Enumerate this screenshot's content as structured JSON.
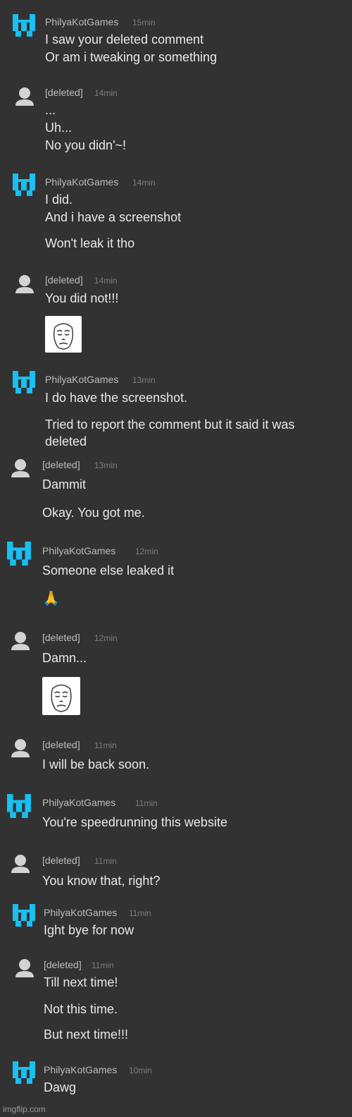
{
  "comments": [
    {
      "user": "PhilyaKotGames",
      "time": "15min",
      "lines": [
        "I saw your deleted comment",
        "Or am i tweaking or something"
      ]
    },
    {
      "user": "[deleted]",
      "time": "14min",
      "lines": [
        "...",
        "Uh...",
        "No you didn'~!"
      ]
    },
    {
      "user": "PhilyaKotGames",
      "time": "14min",
      "lines": [
        "I did.",
        "And i have a screenshot",
        "Won't leak it tho"
      ]
    },
    {
      "user": "[deleted]",
      "time": "14min",
      "lines": [
        "You did not!!!"
      ]
    },
    {
      "user": "PhilyaKotGames",
      "time": "13min",
      "lines": [
        "I do have the screenshot.",
        "Tried to report the comment but it said it was",
        "deleted"
      ]
    },
    {
      "user": "[deleted]",
      "time": "13min",
      "lines": [
        "Dammit",
        "Okay. You got me."
      ]
    },
    {
      "user": "PhilyaKotGames",
      "time": "12min",
      "lines": [
        "Someone else leaked it",
        "🙏"
      ]
    },
    {
      "user": "[deleted]",
      "time": "12min",
      "lines": [
        "Damn..."
      ]
    },
    {
      "user": "[deleted]",
      "time": "11min",
      "lines": [
        "I will be back soon."
      ]
    },
    {
      "user": "PhilyaKotGames",
      "time": "11min",
      "lines": [
        "You're speedrunning this website"
      ]
    },
    {
      "user": "[deleted]",
      "time": "11min",
      "lines": [
        "You know that, right?"
      ]
    },
    {
      "user": "PhilyaKotGames",
      "time": "11min",
      "lines": [
        "Ight bye for now"
      ]
    },
    {
      "user": "[deleted]",
      "time": "11min",
      "lines": [
        "Till next time!",
        "Not this time.",
        "But next time!!!"
      ]
    },
    {
      "user": "PhilyaKotGames",
      "time": "10min",
      "lines": [
        "Dawg"
      ]
    }
  ],
  "watermark": "imgflip.com",
  "colors": {
    "background": "#323232",
    "brand_avatar": "#19bff0",
    "deleted_avatar": "#d3d3d3"
  }
}
